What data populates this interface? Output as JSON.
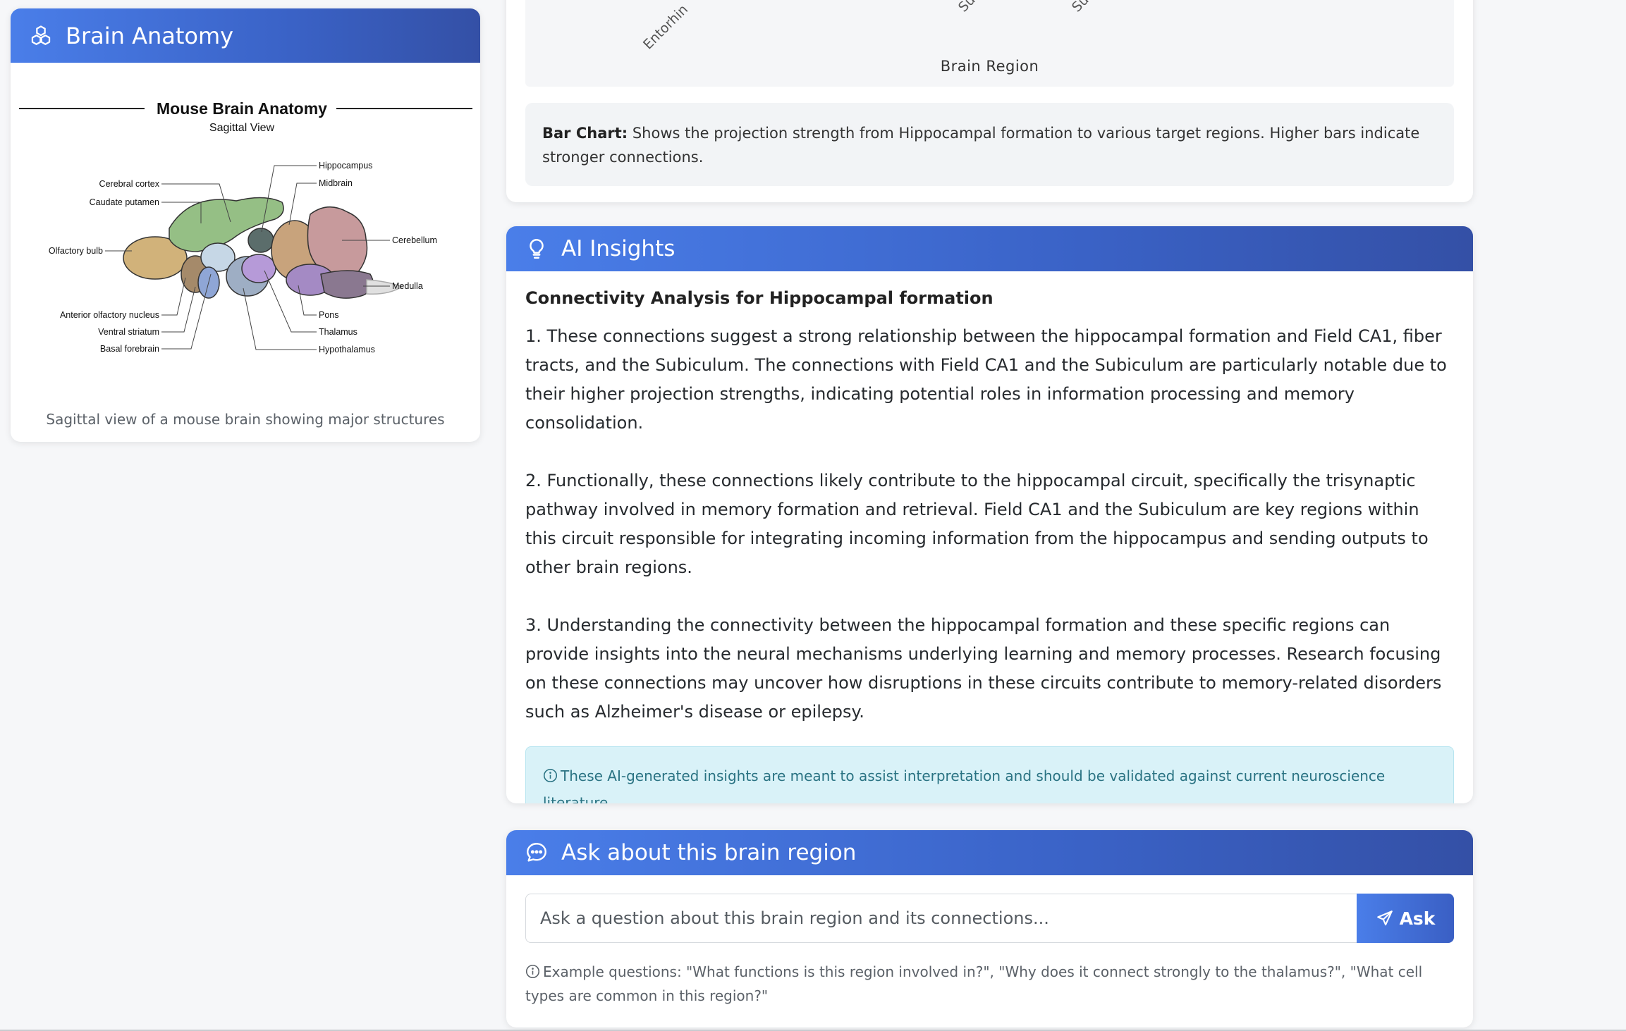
{
  "anatomy": {
    "header_title": "Brain Anatomy",
    "figure_title": "Mouse Brain Anatomy",
    "figure_subtitle": "Sagittal View",
    "labels_left": [
      "Cerebral cortex",
      "Caudate putamen",
      "Olfactory bulb",
      "Anterior olfactory nucleus",
      "Ventral striatum",
      "Basal forebrain"
    ],
    "labels_right": [
      "Hippocampus",
      "Midbrain",
      "Cerebellum",
      "Medulla",
      "Pons",
      "Thalamus",
      "Hypothalamus"
    ],
    "caption": "Sagittal view of a mouse brain showing major structures"
  },
  "chart": {
    "tick_labels": [
      "Entorhin",
      "Su",
      "Su"
    ],
    "xlabel": "Brain Region",
    "desc_bold": "Bar Chart:",
    "desc_text": " Shows the projection strength from Hippocampal formation to various target regions. Higher bars indicate stronger connections."
  },
  "insights": {
    "header_title": "AI Insights",
    "title": "Connectivity Analysis for Hippocampal formation",
    "paragraphs": [
      "1. These connections suggest a strong relationship between the hippocampal formation and Field CA1, fiber tracts, and the Subiculum. The connections with Field CA1 and the Subiculum are particularly notable due to their higher projection strengths, indicating potential roles in information processing and memory consolidation.",
      "2. Functionally, these connections likely contribute to the hippocampal circuit, specifically the trisynaptic pathway involved in memory formation and retrieval. Field CA1 and the Subiculum are key regions within this circuit responsible for integrating incoming information from the hippocampus and sending outputs to other brain regions.",
      "3. Understanding the connectivity between the hippocampal formation and these specific regions can provide insights into the neural mechanisms underlying learning and memory processes. Research focusing on these connections may uncover how disruptions in these circuits contribute to memory-related disorders such as Alzheimer's disease or epilepsy."
    ],
    "disclaimer": "These AI-generated insights are meant to assist interpretation and should be validated against current neuroscience literature."
  },
  "ask": {
    "header_title": "Ask about this brain region",
    "placeholder": "Ask a question about this brain region and its connections...",
    "button_label": "Ask",
    "hint": "Example questions: \"What functions is this region involved in?\", \"Why does it connect strongly to the thalamus?\", \"What cell types are common in this region?\""
  }
}
